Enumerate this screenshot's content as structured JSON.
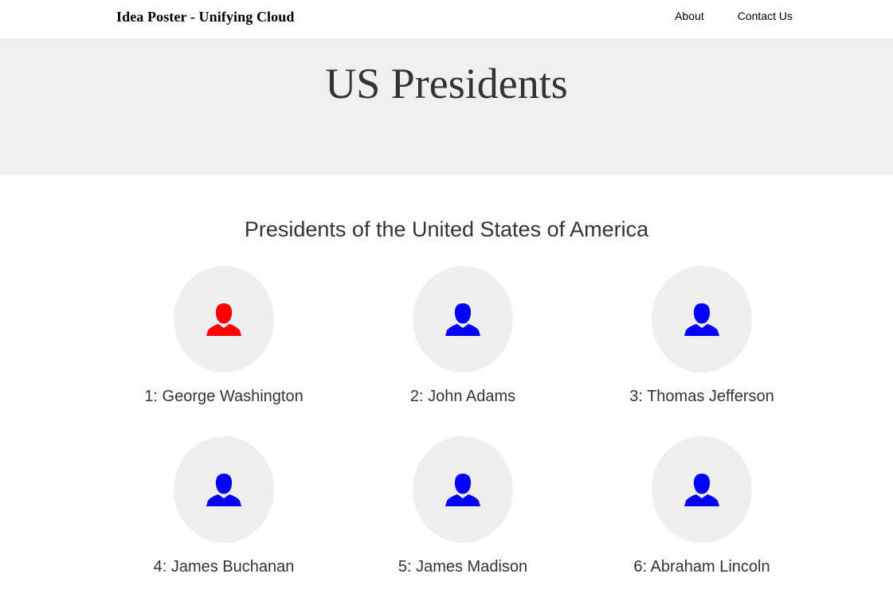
{
  "navbar": {
    "brand": "Idea Poster - Unifying Cloud",
    "links": [
      {
        "label": "About"
      },
      {
        "label": "Contact Us"
      }
    ]
  },
  "hero": {
    "title": "US Presidents"
  },
  "section": {
    "title": "Presidents of the United States of America"
  },
  "presidents": [
    {
      "label": "1: George Washington",
      "icon": "person-icon",
      "icon_color": "#ff0000"
    },
    {
      "label": "2: John Adams",
      "icon": "person-icon",
      "icon_color": "#0000ff"
    },
    {
      "label": "3: Thomas Jefferson",
      "icon": "person-icon",
      "icon_color": "#0000ff"
    },
    {
      "label": "4: James Buchanan",
      "icon": "person-icon",
      "icon_color": "#0000ff"
    },
    {
      "label": "5: James Madison",
      "icon": "person-icon",
      "icon_color": "#0000ff"
    },
    {
      "label": "6: Abraham Lincoln",
      "icon": "person-icon",
      "icon_color": "#0000ff"
    }
  ],
  "colors": {
    "hero_background": "#f0f0f0",
    "avatar_background": "#efefef",
    "text": "#333333"
  }
}
